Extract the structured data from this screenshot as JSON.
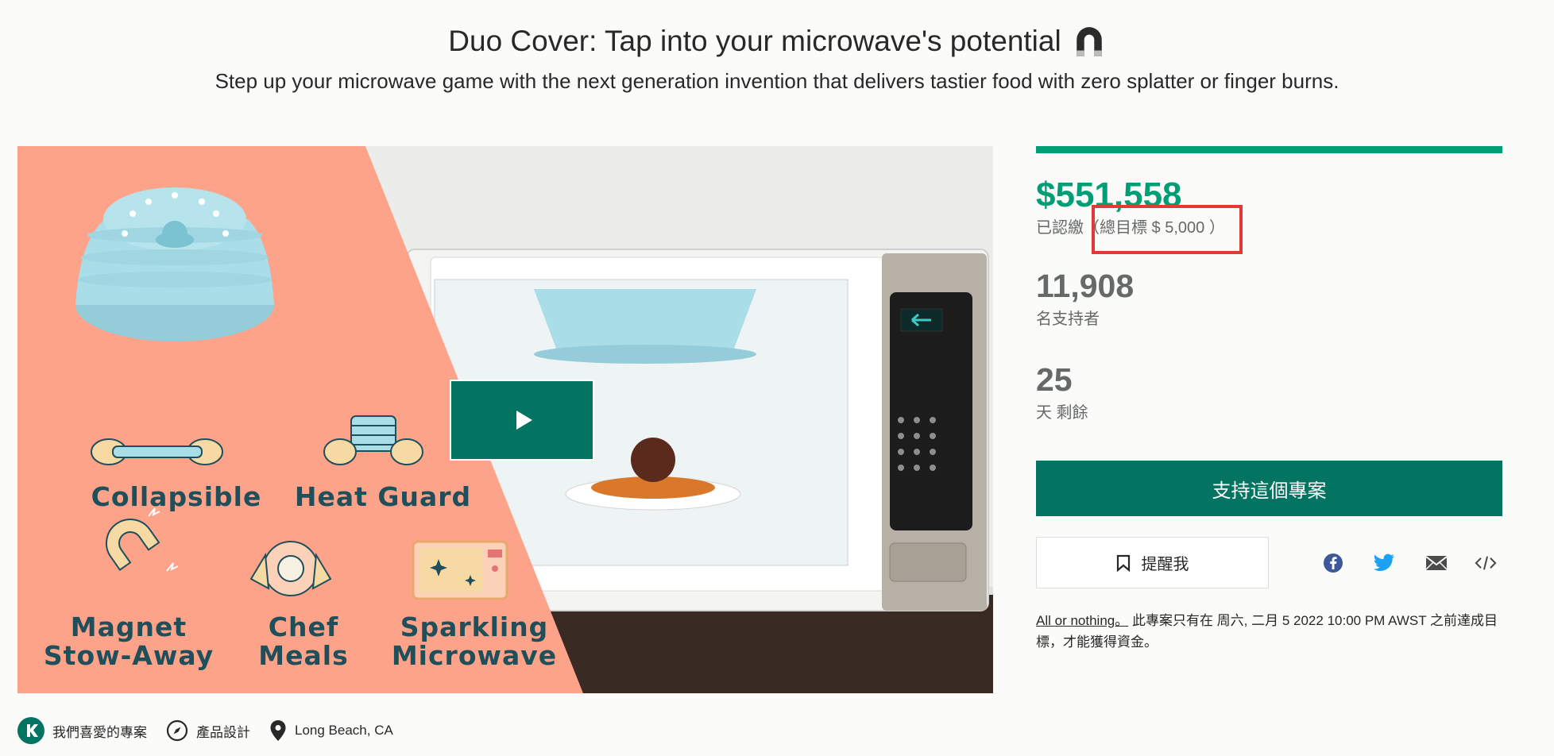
{
  "header": {
    "title": "Duo Cover: Tap into your microwave's potential",
    "subtitle": "Step up your microwave game with the next generation invention that delivers tastier food with zero splatter or finger burns."
  },
  "media": {
    "features": [
      {
        "label_line1": "Collapsible",
        "label_line2": ""
      },
      {
        "label_line1": "Heat Guard",
        "label_line2": ""
      },
      {
        "label_line1": "Magnet",
        "label_line2": "Stow-Away"
      },
      {
        "label_line1": "Chef",
        "label_line2": "Meals"
      },
      {
        "label_line1": "Sparkling",
        "label_line2": "Microwave"
      }
    ],
    "product_mark": "Duo Cover",
    "play_icon": "play-icon"
  },
  "campaign": {
    "progress_fraction": 1.0,
    "pledged_amount": "$551,558",
    "pledged_label": "已認繳",
    "goal_text": "（總目標 $ 5,000 ）",
    "backers_count": "11,908",
    "backers_label": "名支持者",
    "days_left": "25",
    "days_label": "天 剩餘",
    "back_button": "支持這個專案",
    "remind_button": "提醒我",
    "note_link": "All or nothing。",
    "note_text": " 此專案只有在 周六, 二月 5 2022 10:00 PM AWST 之前達成目標，才能獲得資金。"
  },
  "share": [
    "facebook-icon",
    "twitter-icon",
    "email-icon",
    "embed-icon"
  ],
  "tags": [
    {
      "icon": "kickstarter-k-icon",
      "label": "我們喜愛的專案"
    },
    {
      "icon": "compass-icon",
      "label": "產品設計"
    },
    {
      "icon": "location-pin-icon",
      "label": "Long Beach, CA"
    }
  ],
  "colors": {
    "brand_green": "#037362",
    "funded_green": "#009e74",
    "salmon": "#fda38a",
    "cover_blue": "#a9dde8",
    "highlight_red": "#e53935"
  }
}
